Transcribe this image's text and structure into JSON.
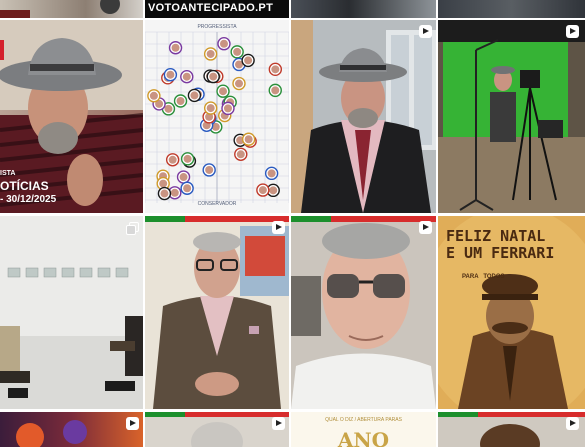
{
  "tiles": {
    "top_banner_handle": "VOTOANTECIPADO.PT",
    "news_caption": {
      "line1": "ISTA",
      "line2": "OTÍCIAS",
      "line3": "- 30/12/2025"
    },
    "spectrum_chart": {
      "top_label": "PROGRESSISTA",
      "bottom_label": "CONSERVADOR"
    },
    "christmas_cake": {
      "line1": "FELIZ NATAL",
      "line2": "E UM FERRARI",
      "line3": "PARA   TODOS"
    },
    "bottom_partial_text": "QUAL O DIZ / ABERTURA PARAS",
    "bottom_partial_logo": "ANO"
  },
  "icons": {
    "reel": "reel-icon",
    "carousel": "carousel-icon"
  }
}
